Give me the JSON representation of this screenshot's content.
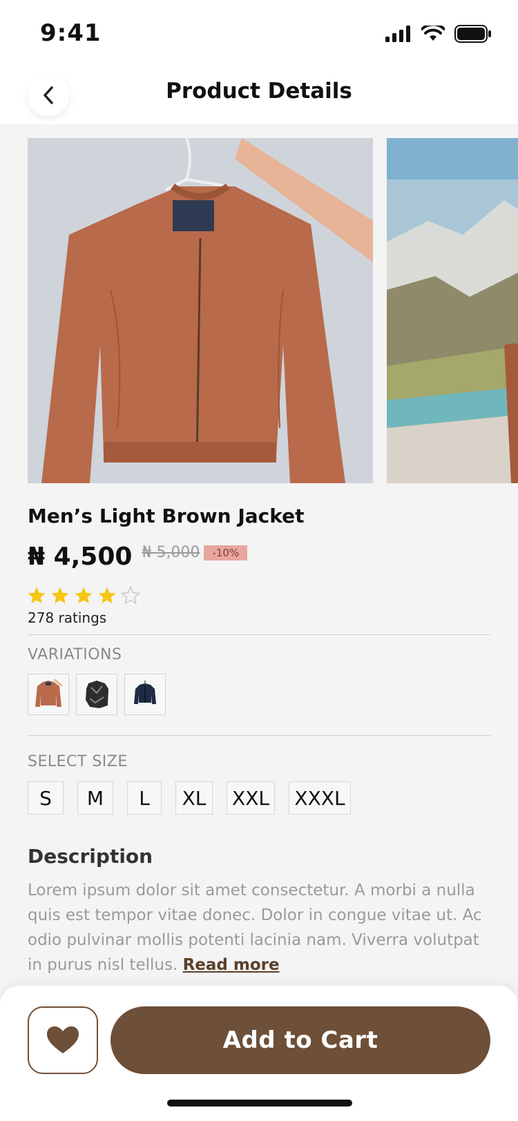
{
  "status_bar": {
    "time": "9:41"
  },
  "header": {
    "title": "Product Details"
  },
  "product": {
    "name": "Men’s Light  Brown Jacket",
    "price": "₦ 4,500",
    "old_price": "₦ 5,000",
    "discount": "-10%",
    "rating": 4,
    "rating_max": 5,
    "ratings_count": "278 ratings"
  },
  "variations": {
    "label": "VARIATIONS",
    "items": [
      "brown-jacket",
      "black-jacket",
      "navy-jacket"
    ]
  },
  "sizes": {
    "label": "SELECT SIZE",
    "options": [
      "S",
      "M",
      "L",
      "XL",
      "XXL",
      "XXXL"
    ]
  },
  "description": {
    "title": "Description",
    "text": "Lorem ipsum dolor sit amet consectetur. A morbi a nulla quis est tempor vitae donec. Dolor in congue vitae ut. Ac odio pulvinar mollis potenti lacinia nam. Viverra volutpat in purus nisl tellus. ",
    "read_more": "Read more"
  },
  "actions": {
    "add_to_cart": "Add to Cart"
  },
  "colors": {
    "accent": "#6e4f38",
    "star": "#f6c515",
    "discount_bg": "#e7a6a0"
  }
}
